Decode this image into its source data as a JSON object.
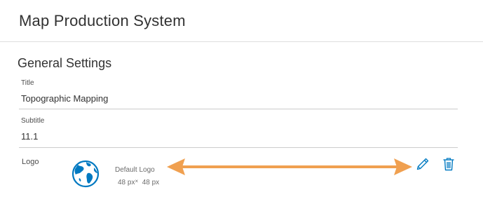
{
  "header": {
    "app_title": "Map Production System"
  },
  "settings": {
    "section_title": "General Settings",
    "title_field": {
      "label": "Title",
      "value": "Topographic Mapping"
    },
    "subtitle_field": {
      "label": "Subtitle",
      "value": "11.1"
    },
    "logo": {
      "label": "Logo",
      "name": "Default Logo",
      "width": "48 px",
      "height": "48 px",
      "icon": "globe-icon"
    },
    "actions": {
      "edit_icon": "pencil-icon",
      "delete_icon": "trash-icon"
    }
  },
  "colors": {
    "accent": "#0079c1",
    "annotation_arrow": "#f0a050",
    "divider": "#cccccc"
  }
}
